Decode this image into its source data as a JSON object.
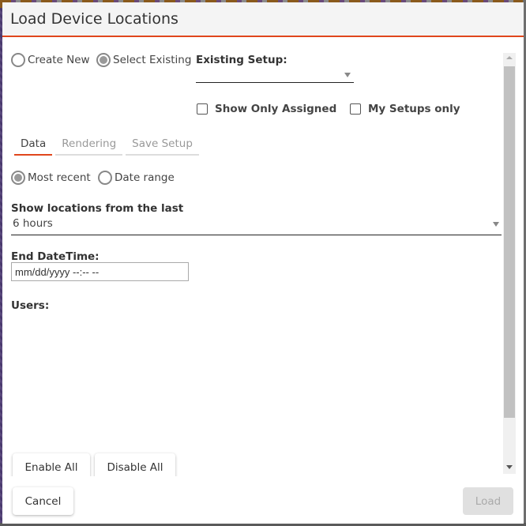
{
  "dialog": {
    "title": "Load Device Locations"
  },
  "mode": {
    "options": [
      {
        "label": "Create New",
        "checked": false
      },
      {
        "label": "Select Existing",
        "checked": true
      }
    ]
  },
  "existing_setup": {
    "label": "Existing Setup:",
    "value": ""
  },
  "filters": {
    "show_only_assigned": {
      "label": "Show Only Assigned",
      "checked": false
    },
    "my_setups_only": {
      "label": "My Setups only",
      "checked": false
    }
  },
  "tabs": [
    {
      "label": "Data",
      "active": true
    },
    {
      "label": "Rendering",
      "active": false
    },
    {
      "label": "Save Setup",
      "active": false
    }
  ],
  "time_mode": {
    "options": [
      {
        "label": "Most recent",
        "checked": true
      },
      {
        "label": "Date range",
        "checked": false
      }
    ]
  },
  "show_locations": {
    "label": "Show locations from the last",
    "value": "6 hours"
  },
  "end_datetime": {
    "label": "End DateTime:",
    "placeholder": "mm/dd/yyyy --:-- --"
  },
  "users": {
    "label": "Users:"
  },
  "buttons": {
    "enable_all": "Enable All",
    "disable_all": "Disable All",
    "cancel": "Cancel",
    "load": "Load"
  },
  "colors": {
    "accent": "#e0461c",
    "header_bg": "#f4f4f4"
  }
}
